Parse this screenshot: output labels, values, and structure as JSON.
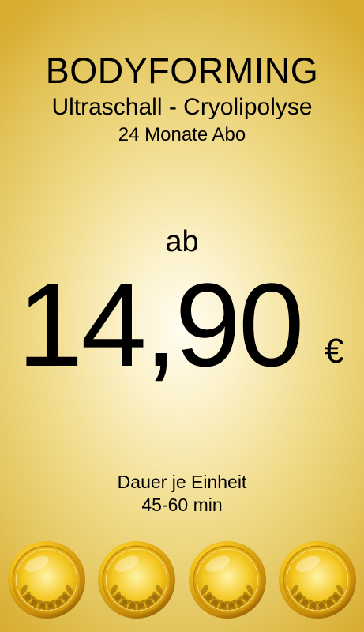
{
  "header": {
    "title": "BODYFORMING",
    "subtitle": "Ultraschall - Cryolipolyse",
    "term": "24 Monate Abo"
  },
  "price": {
    "prefix": "ab",
    "amount": "14,90",
    "currency": "€"
  },
  "duration": {
    "label": "Dauer je Einheit",
    "value": "45-60 min"
  },
  "medals": {
    "count": 4,
    "icon": "gold-laurel-medal-icon",
    "colors": [
      "#fff4a8",
      "#f3c51c",
      "#c78a0a",
      "#8d5c06"
    ]
  },
  "background": {
    "center_color": "#fffdf2",
    "edge_color": "#d7ac2f"
  }
}
